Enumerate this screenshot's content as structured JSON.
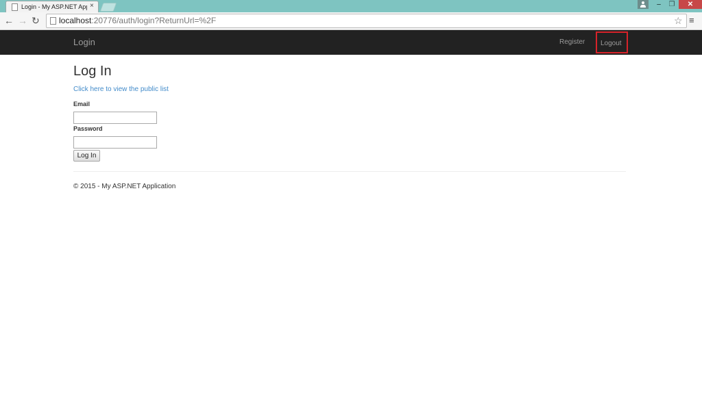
{
  "browser": {
    "tab_title": "Login - My ASP.NET Applic",
    "tab_close": "×",
    "url_host": "localhost",
    "url_path": ":20776/auth/login?ReturnUrl=%2F",
    "icons": [
      "page-icon",
      "back-icon",
      "forward-icon",
      "reload-icon",
      "star-icon",
      "menu-icon",
      "user-icon"
    ],
    "window_controls": {
      "minimize": "‒",
      "maximize": "❐",
      "close": "✕"
    }
  },
  "navbar": {
    "brand": "Login",
    "links": [
      {
        "label": "Register"
      },
      {
        "label": "Logout",
        "highlighted": true
      }
    ],
    "background": "#222222",
    "link_color": "#9d9d9d",
    "highlight_color": "#d8232a"
  },
  "main": {
    "title": "Log In",
    "public_link": "Click here to view the public list",
    "email_label": "Email",
    "email_value": "",
    "password_label": "Password",
    "password_value": "",
    "submit_label": "Log In",
    "link_color": "#428bca"
  },
  "footer": {
    "text": "© 2015 - My ASP.NET Application"
  }
}
